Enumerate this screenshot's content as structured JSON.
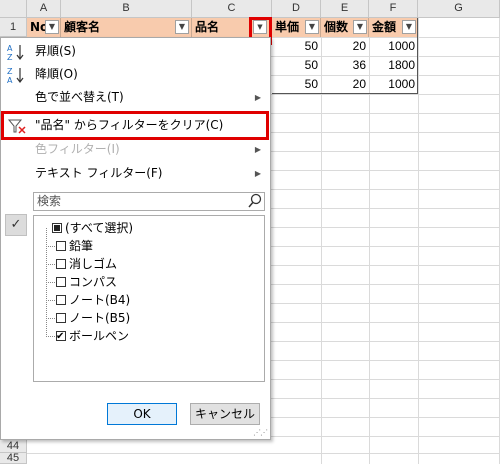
{
  "sheet": {
    "columns": [
      "A",
      "B",
      "C",
      "D",
      "E",
      "F",
      "G"
    ],
    "row_numbers": {
      "first": "1",
      "last": "44",
      "next": "45"
    },
    "header_row": {
      "no": "No",
      "customer": "顧客名",
      "product": "品名",
      "unit_price": "単価",
      "quantity": "個数",
      "amount": "金額"
    },
    "rows": [
      {
        "unit_price": "50",
        "quantity": "20",
        "amount": "1000"
      },
      {
        "unit_price": "50",
        "quantity": "36",
        "amount": "1800"
      },
      {
        "unit_price": "50",
        "quantity": "20",
        "amount": "1000"
      }
    ],
    "header_fill": "#f8cbad"
  },
  "filter_menu": {
    "sort_asc": "昇順(S)",
    "sort_desc": "降順(O)",
    "sort_by_color": "色で並べ替え(T)",
    "clear_filter": "\"品名\" からフィルターをクリア(C)",
    "color_filter": "色フィルター(I)",
    "text_filter": "テキスト フィルター(F)",
    "search_placeholder": "検索",
    "items": [
      {
        "label": "(すべて選択)",
        "state": "partial"
      },
      {
        "label": "鉛筆",
        "state": "unchecked"
      },
      {
        "label": "消しゴム",
        "state": "unchecked"
      },
      {
        "label": "コンパス",
        "state": "unchecked"
      },
      {
        "label": "ノート(B4)",
        "state": "unchecked"
      },
      {
        "label": "ノート(B5)",
        "state": "unchecked"
      },
      {
        "label": "ボールペン",
        "state": "checked"
      }
    ],
    "ok": "OK",
    "cancel": "キャンセル"
  },
  "icons": {
    "sort_asc": "sort-ascending-icon",
    "sort_desc": "sort-descending-icon",
    "clear": "clear-filter-icon",
    "search": "search-icon",
    "filter_active": "filter-active-icon"
  },
  "colors": {
    "highlight": "#e00000",
    "accent": "#0078d7"
  }
}
